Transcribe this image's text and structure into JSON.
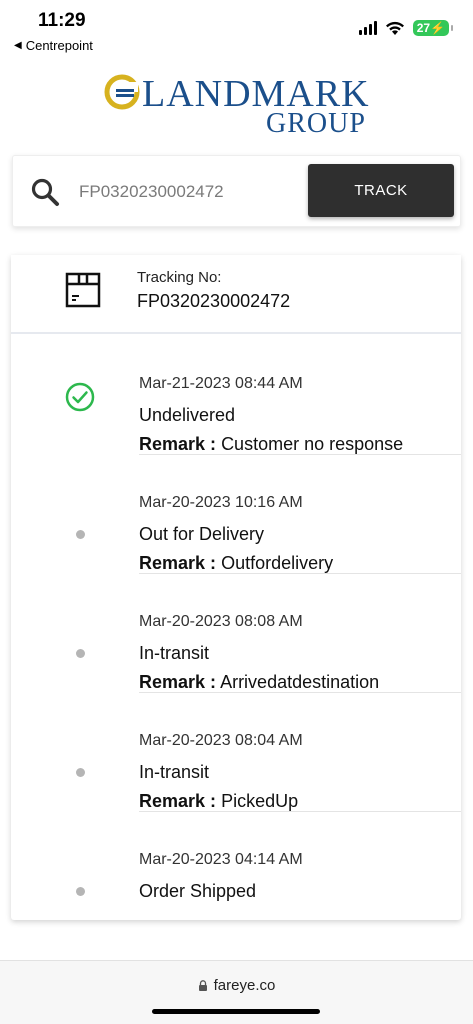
{
  "status_bar": {
    "time": "11:29",
    "back_app": "Centrepoint",
    "battery": "27"
  },
  "logo": {
    "word1": "LANDMARK",
    "word2": "GROUP"
  },
  "search": {
    "value": "FP0320230002472",
    "button_label": "TRACK"
  },
  "tracking": {
    "label": "Tracking No:",
    "number": "FP0320230002472"
  },
  "events": [
    {
      "time": "Mar-21-2023 08:44 AM",
      "status": "Undelivered",
      "remark_label": "Remark :",
      "remark": "Customer no response",
      "completed": true
    },
    {
      "time": "Mar-20-2023 10:16 AM",
      "status": "Out for Delivery",
      "remark_label": "Remark :",
      "remark": "Outfordelivery",
      "completed": false
    },
    {
      "time": "Mar-20-2023 08:08 AM",
      "status": "In-transit",
      "remark_label": "Remark :",
      "remark": "Arrivedatdestination",
      "completed": false
    },
    {
      "time": "Mar-20-2023 08:04 AM",
      "status": "In-transit",
      "remark_label": "Remark :",
      "remark": "PickedUp",
      "completed": false
    },
    {
      "time": "Mar-20-2023 04:14 AM",
      "status": "Order Shipped",
      "completed": false
    }
  ],
  "browser": {
    "url": "fareye.co"
  },
  "colors": {
    "logo_blue": "#1b4f8b",
    "logo_gold": "#d7b21f",
    "check_green": "#2db84d",
    "button_dark": "#2f2f2f"
  }
}
